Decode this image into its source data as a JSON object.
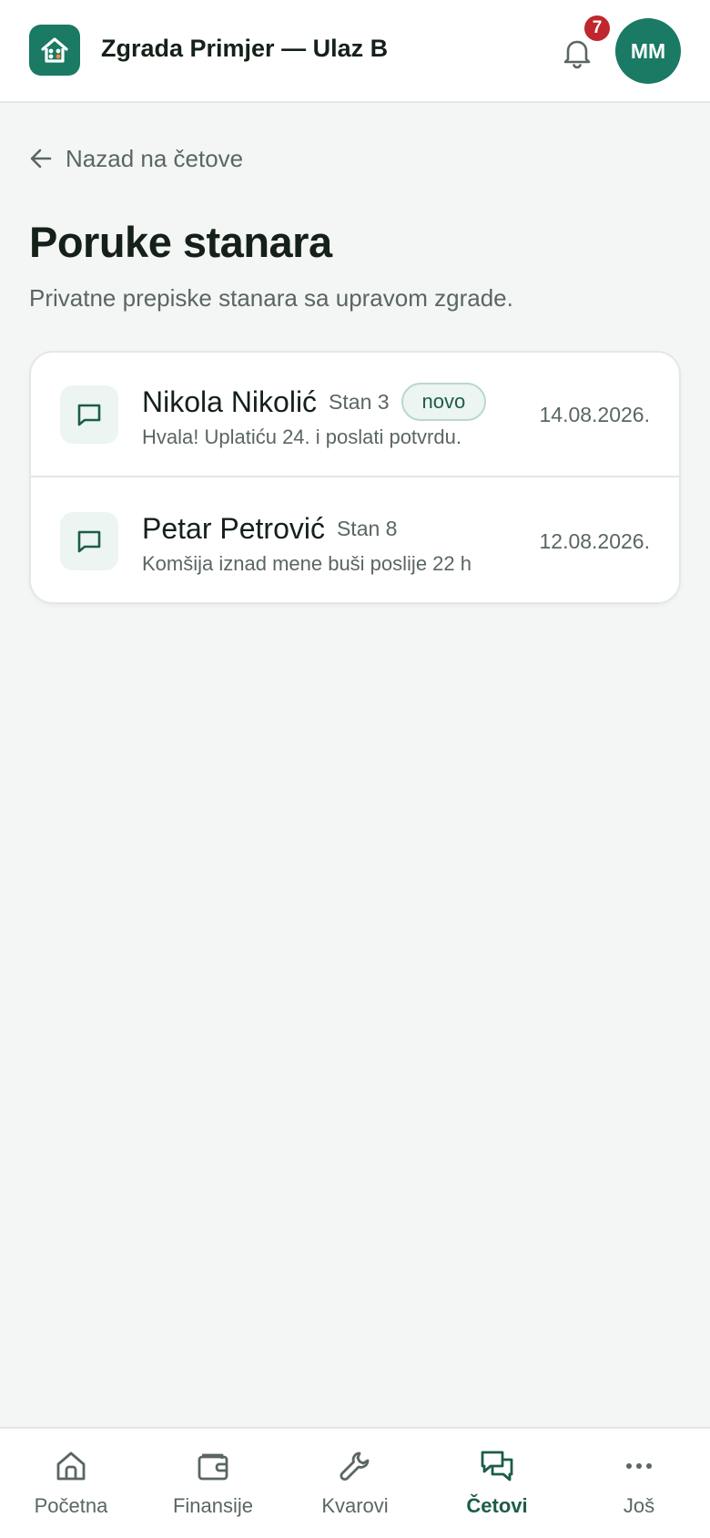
{
  "header": {
    "building_name": "Zgrada Primjer — Ulaz B",
    "notification_count": "7",
    "avatar_initials": "MM"
  },
  "back_link": {
    "label": "Nazad na četove"
  },
  "page": {
    "title": "Poruke stanara",
    "subtitle": "Privatne prepiske stanara sa upravom zgrade."
  },
  "chats": [
    {
      "name": "Nikola Nikolić",
      "unit": "Stan 3",
      "badge": "novo",
      "preview": "Hvala! Uplatiću 24. i poslati potvrdu.",
      "date": "14.08.2026."
    },
    {
      "name": "Petar Petrović",
      "unit": "Stan 8",
      "preview": "Komšija iznad mene buši poslije 22 h",
      "date": "12.08.2026."
    }
  ],
  "nav": [
    {
      "label": "Početna",
      "icon": "home-icon"
    },
    {
      "label": "Finansije",
      "icon": "wallet-icon"
    },
    {
      "label": "Kvarovi",
      "icon": "wrench-icon"
    },
    {
      "label": "Četovi",
      "icon": "chat-bubbles-icon",
      "active": true
    },
    {
      "label": "Još",
      "icon": "more-dots-icon"
    }
  ],
  "colors": {
    "brand": "#1a7a63",
    "brand_dark": "#1c5c4a",
    "badge_red": "#c0262d",
    "background": "#f4f6f6",
    "text_muted": "#5a6663"
  }
}
